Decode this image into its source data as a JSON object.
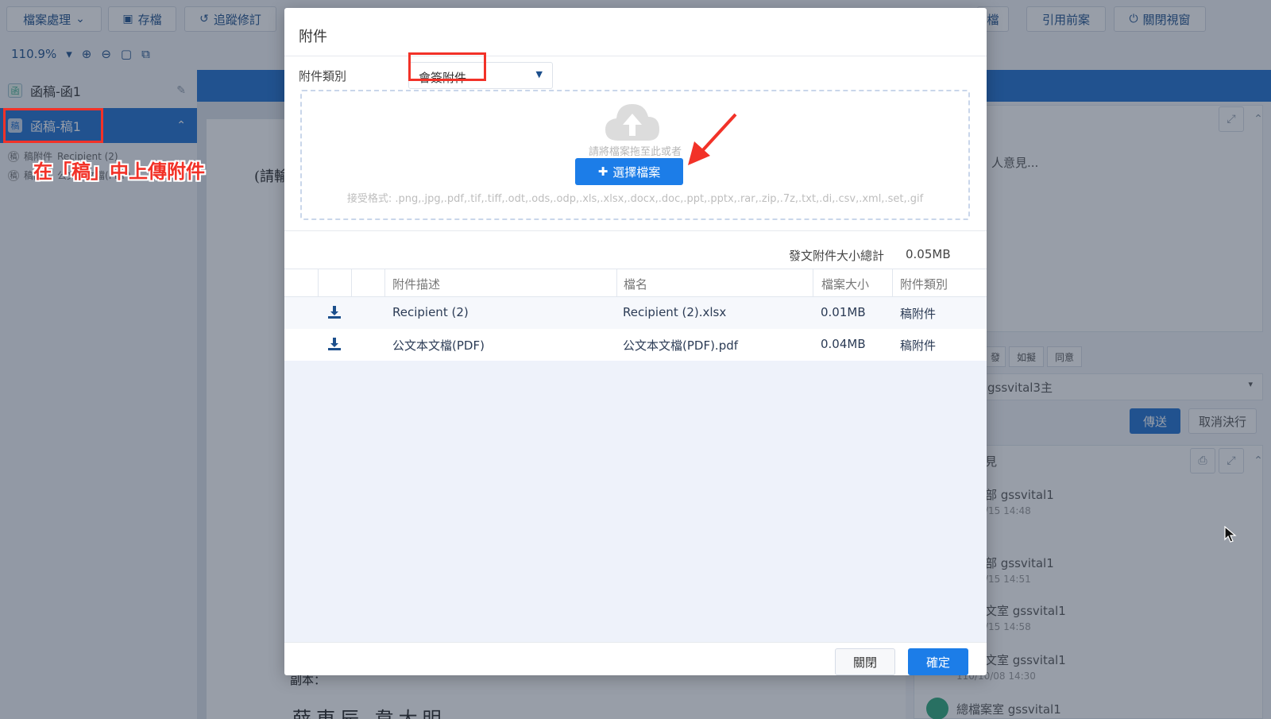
{
  "toolbar": {
    "file_menu": "檔案處理",
    "save": "存檔",
    "track_changes": "追蹤修訂",
    "hidden_partial": "檔",
    "cite_previous": "引用前案",
    "close_view": "關閉視窗"
  },
  "zoom": {
    "level": "110.9%"
  },
  "tree": {
    "item1": "函稿-函1",
    "item2": "函稿-稿1",
    "sub1_tag": "稿附件",
    "sub1_name": "Recipient (2)",
    "sub2_tag": "稿附件",
    "sub2_name": "公文本文檔(PDF)"
  },
  "annotation": {
    "caption": "在「稿」中上傳附件"
  },
  "document": {
    "line1": "(請輸",
    "line2": "副本：",
    "line3": "薛東辰 韋大明"
  },
  "right_panel": {
    "opinion_placeholder": "人意見...",
    "quick_btns": [
      "發",
      "如擬",
      "同意"
    ],
    "assignee": "gssvital3主",
    "send": "傳送",
    "cancel": "取消決行",
    "section_title": "見",
    "log": [
      {
        "name": "部 gssvital1",
        "time": "/15  14:48"
      },
      {
        "name": "部 gssvital1",
        "time": "/15  14:51"
      },
      {
        "name": "文室 gssvital1",
        "time": "/15  14:58"
      },
      {
        "name": "文室 gssvital1",
        "time": "110/10/08  14:30"
      },
      {
        "name": "總檔案室 gssvital1",
        "time": ""
      }
    ]
  },
  "modal": {
    "title": "附件",
    "category_label": "附件類別",
    "category_value": "會簽附件",
    "drop_hint": "請將檔案拖至此或者",
    "choose_button": "選擇檔案",
    "formats": "接受格式: .png,.jpg,.pdf,.tif,.tiff,.odt,.ods,.odp,.xls,.xlsx,.docx,.doc,.ppt,.pptx,.rar,.zip,.7z,.txt,.di,.csv,.xml,.set,.gif",
    "total_label": "發文附件大小總計",
    "total_value": "0.05MB",
    "columns": [
      "附件描述",
      "檔名",
      "檔案大小",
      "附件類別"
    ],
    "rows": [
      {
        "desc": "Recipient (2)",
        "file": "Recipient (2).xlsx",
        "size": "0.01MB",
        "type": "稿附件"
      },
      {
        "desc": "公文本文檔(PDF)",
        "file": "公文本文檔(PDF).pdf",
        "size": "0.04MB",
        "type": "稿附件"
      }
    ],
    "close_button": "關閉",
    "ok_button": "確定"
  },
  "colors": {
    "primary": "#1c7de8",
    "annotation": "#f23228"
  }
}
